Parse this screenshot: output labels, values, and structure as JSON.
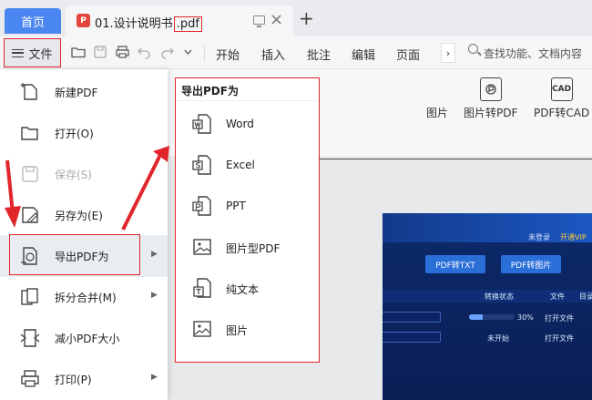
{
  "tabbar": {
    "home_label": "首页",
    "doc_name": "01.设计说明书",
    "doc_ext": ".pdf",
    "pdf_badge": "P",
    "new_tab": "+",
    "close": "×"
  },
  "toolbar": {
    "file_label": "文件",
    "tabs": [
      "开始",
      "插入",
      "批注",
      "编辑",
      "页面"
    ],
    "more": "›",
    "search_placeholder": "查找功能、文档内容"
  },
  "ribbon": {
    "buttons": [
      {
        "label": "图片"
      },
      {
        "label": "图片转PDF"
      },
      {
        "label": "PDF转CAD",
        "icon_text": "CAD"
      }
    ]
  },
  "file_menu": {
    "items": [
      {
        "label": "新建PDF",
        "icon": "new-pdf-icon",
        "enabled": true,
        "submenu": false
      },
      {
        "label": "打开(O)",
        "icon": "folder-open-icon",
        "enabled": true,
        "submenu": false
      },
      {
        "label": "保存(S)",
        "icon": "save-icon",
        "enabled": false,
        "submenu": false
      },
      {
        "label": "另存为(E)",
        "icon": "save-as-icon",
        "enabled": true,
        "submenu": false
      },
      {
        "label": "导出PDF为",
        "icon": "export-pdf-icon",
        "enabled": true,
        "submenu": true
      },
      {
        "label": "拆分合并(M)",
        "icon": "split-merge-icon",
        "enabled": true,
        "submenu": true
      },
      {
        "label": "减小PDF大小",
        "icon": "compress-icon",
        "enabled": true,
        "submenu": false
      },
      {
        "label": "打印(P)",
        "icon": "print-icon",
        "enabled": true,
        "submenu": true
      }
    ]
  },
  "export_submenu": {
    "title": "导出PDF为",
    "items": [
      {
        "label": "Word",
        "icon": "word-icon"
      },
      {
        "label": "Excel",
        "icon": "excel-icon"
      },
      {
        "label": "PPT",
        "icon": "ppt-icon"
      },
      {
        "label": "图片型PDF",
        "icon": "image-pdf-icon"
      },
      {
        "label": "纯文本",
        "icon": "text-icon"
      },
      {
        "label": "图片",
        "icon": "image-icon"
      }
    ]
  },
  "embedded_app": {
    "login": "未登录",
    "vip": "开通VIP",
    "btn_pdf_txt": "PDF转TXT",
    "btn_pdf_img": "PDF转图片",
    "col_status": "转换状态",
    "col_file": "文件",
    "col_dir": "目录",
    "row1_percent": "30%",
    "row1_action": "打开文件",
    "row2_status": "未开始",
    "row2_action": "打开文件",
    "progress": 0.3
  },
  "colors": {
    "accent": "#4b87f0",
    "highlight": "#e0262b",
    "pdf_red": "#e2463c"
  }
}
